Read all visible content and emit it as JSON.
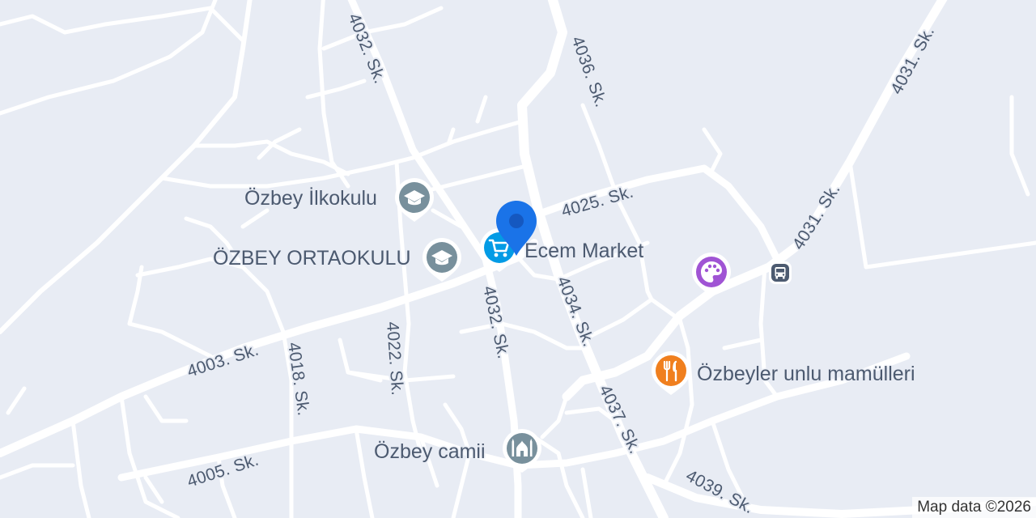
{
  "map": {
    "streets": {
      "s4032_top": "4032. Sk.",
      "s4036": "4036. Sk.",
      "s4031": "4031. Sk.",
      "s4025": "4025. Sk.",
      "s4031_mid": "4031. Sk.",
      "s4034": "4034. Sk.",
      "s4032_mid": "4032. Sk.",
      "s4003": "4003. Sk.",
      "s4022": "4022. Sk.",
      "s4018": "4018. Sk.",
      "s4037": "4037. Sk.",
      "s4005": "4005. Sk.",
      "s4039": "4039. Sk."
    },
    "pois": {
      "school1": {
        "name": "Özbey İlkokulu",
        "icon": "school-icon",
        "color": "#78909c"
      },
      "school2": {
        "name": "ÖZBEY ORTAOKULU",
        "icon": "school-icon",
        "color": "#78909c"
      },
      "market": {
        "name": "Ecem Market",
        "icon": "shopping-cart-icon",
        "color": "#039be5"
      },
      "art": {
        "name": "",
        "icon": "palette-icon",
        "color": "#a054d4"
      },
      "bakery": {
        "name": "Özbeyler unlu mamülleri",
        "icon": "restaurant-icon",
        "color": "#f07f1e"
      },
      "mosque": {
        "name": "Özbey camii",
        "icon": "mosque-icon",
        "color": "#78909c"
      },
      "bus": {
        "name": "",
        "icon": "bus-stop-icon",
        "color": "#4c5a70"
      }
    },
    "selected_pin": {
      "icon": "location-pin-icon",
      "color": "#1a73e8"
    },
    "attribution": "Map data ©2026"
  }
}
